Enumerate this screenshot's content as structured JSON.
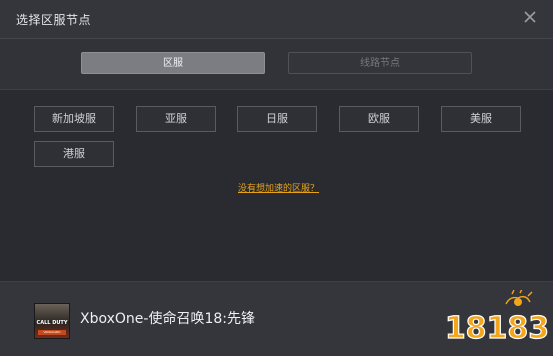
{
  "dialog": {
    "title": "选择区服节点"
  },
  "tabs": [
    {
      "label": "区服",
      "active": true
    },
    {
      "label": "线路节点",
      "active": false
    }
  ],
  "servers": [
    {
      "label": "新加坡服"
    },
    {
      "label": "亚服"
    },
    {
      "label": "日服"
    },
    {
      "label": "欧服"
    },
    {
      "label": "美服"
    },
    {
      "label": "港服"
    }
  ],
  "hint": "没有想加速的区服？",
  "game": {
    "title": "XboxOne-使命召唤18:先锋",
    "cover_text_line1": "CALL DUTY",
    "cover_text_line2": "VANGUARD"
  },
  "watermark": {
    "text": "18183"
  },
  "colors": {
    "background": "#2a2b30",
    "header": "#35363c",
    "active_tab": "#7c7d82",
    "hint_link": "#e8a21a",
    "watermark_orange": "#f3a51c"
  },
  "icons": {
    "close": "close-icon"
  }
}
